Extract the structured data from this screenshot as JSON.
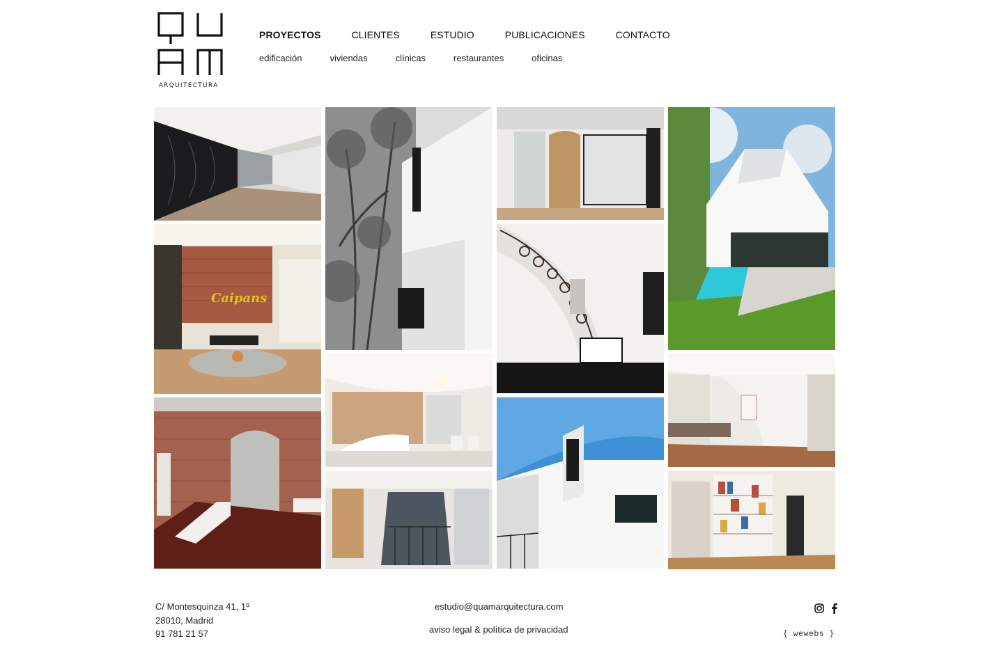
{
  "brand": {
    "logo_letters": "QUAM",
    "logo_subtitle": "ARQUITECTURA"
  },
  "nav": {
    "main": [
      {
        "label": "PROYECTOS",
        "active": true
      },
      {
        "label": "CLIENTES",
        "active": false
      },
      {
        "label": "ESTUDIO",
        "active": false
      },
      {
        "label": "PUBLICACIONES",
        "active": false
      },
      {
        "label": "CONTACTO",
        "active": false
      }
    ],
    "sub": [
      "edificación",
      "viviendas",
      "clínicas",
      "restaurantes",
      "oficinas"
    ]
  },
  "footer": {
    "address_line1": "C/ Montesquinza 41, 1º",
    "address_line2": "28010, Madrid",
    "phone": "91 781 21 57",
    "email": "estudio@quamarquitectura.com",
    "legal": "aviso legal & política de privacidad",
    "credit": "{ wewebs }",
    "social": [
      "instagram-icon",
      "facebook-icon"
    ]
  },
  "colors": {
    "text": "#1a1a1a",
    "background": "#ffffff",
    "sky": "#3d8fd6",
    "brick": "#a65a42",
    "wood": "#b0835a",
    "pool": "#2ec9d8",
    "grass": "#5a9a2a"
  }
}
